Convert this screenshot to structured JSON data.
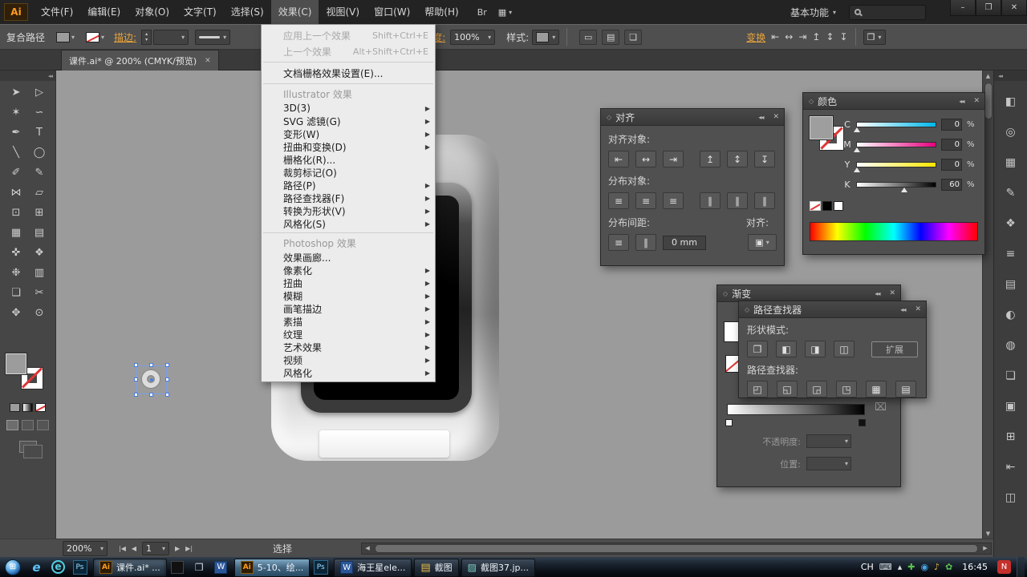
{
  "colors": {
    "accent_link": "#e8a33b",
    "selection_blue": "#4a7dde",
    "ai_brand_orange": "#ff9a1e",
    "menu_bg": "#ececec",
    "panel_bg": "#505050",
    "cyan": "#00b7eb",
    "magenta": "#e6007e",
    "yellow": "#ffe600",
    "black": "#000000"
  },
  "glyphs": {
    "caret_down": "▾",
    "caret_up": "▴",
    "submenu_arrow": "▶",
    "left_arrow": "◀",
    "right_arrow": "▶",
    "up_arrow": "▲",
    "down_arrow": "▼",
    "close": "✕",
    "collapse": "◂◂",
    "panel_menu": "≡",
    "diamond": "◇",
    "minimize": "–",
    "restore": "❐",
    "nav_first": "|◀",
    "nav_last": "▶|",
    "grid": "▦",
    "trash": "⌧",
    "start": "⊞",
    "end_icon": "❒"
  },
  "menubar": {
    "logo_text": "Ai",
    "items": [
      "文件(F)",
      "编辑(E)",
      "对象(O)",
      "文字(T)",
      "选择(S)",
      "效果(C)",
      "视图(V)",
      "窗口(W)",
      "帮助(H)"
    ],
    "bridge_label": "Br",
    "workspace_label": "基本功能"
  },
  "control_bar": {
    "selection_label": "复合路径",
    "stroke_link": "描边:",
    "opacity_link": "不透明度:",
    "opacity_value": "100%",
    "style_label": "样式:",
    "transform_link": "变换",
    "misc_icons": [
      "▭",
      "▤",
      "❏"
    ]
  },
  "document_tab": {
    "title": "课件.ai* @ 200%  (CMYK/预览)"
  },
  "effects_menu": {
    "items": [
      {
        "label": "应用上一个效果",
        "shortcut": "Shift+Ctrl+E",
        "disabled": true
      },
      {
        "label": "上一个效果",
        "shortcut": "Alt+Shift+Ctrl+E",
        "disabled": true
      },
      {
        "label": "文档栅格效果设置(E)..."
      },
      {
        "label": "Illustrator 效果",
        "header": true
      },
      {
        "label": "3D(3)",
        "submenu": true
      },
      {
        "label": "SVG 滤镜(G)",
        "submenu": true
      },
      {
        "label": "变形(W)",
        "submenu": true
      },
      {
        "label": "扭曲和变换(D)",
        "submenu": true
      },
      {
        "label": "栅格化(R)..."
      },
      {
        "label": "裁剪标记(O)"
      },
      {
        "label": "路径(P)",
        "submenu": true
      },
      {
        "label": "路径查找器(F)",
        "submenu": true
      },
      {
        "label": "转换为形状(V)",
        "submenu": true
      },
      {
        "label": "风格化(S)",
        "submenu": true
      },
      {
        "label": "Photoshop 效果",
        "header": true
      },
      {
        "label": "效果画廊..."
      },
      {
        "label": "像素化",
        "submenu": true
      },
      {
        "label": "扭曲",
        "submenu": true
      },
      {
        "label": "模糊",
        "submenu": true
      },
      {
        "label": "画笔描边",
        "submenu": true
      },
      {
        "label": "素描",
        "submenu": true
      },
      {
        "label": "纹理",
        "submenu": true
      },
      {
        "label": "艺术效果",
        "submenu": true
      },
      {
        "label": "视频",
        "submenu": true
      },
      {
        "label": "风格化",
        "submenu": true
      }
    ]
  },
  "tools": [
    {
      "name": "selection-tool",
      "glyph": "➤"
    },
    {
      "name": "direct-selection-tool",
      "glyph": "▷"
    },
    {
      "name": "magic-wand-tool",
      "glyph": "✶"
    },
    {
      "name": "lasso-tool",
      "glyph": "∽"
    },
    {
      "name": "pen-tool",
      "glyph": "✒"
    },
    {
      "name": "type-tool",
      "glyph": "T"
    },
    {
      "name": "line-segment-tool",
      "glyph": "╲"
    },
    {
      "name": "ellipse-tool",
      "glyph": "◯"
    },
    {
      "name": "paintbrush-tool",
      "glyph": "✐"
    },
    {
      "name": "pencil-tool",
      "glyph": "✎"
    },
    {
      "name": "width-tool",
      "glyph": "⋈"
    },
    {
      "name": "free-transform-tool",
      "glyph": "▱"
    },
    {
      "name": "shape-builder-tool",
      "glyph": "⊡"
    },
    {
      "name": "perspective-grid-tool",
      "glyph": "⊞"
    },
    {
      "name": "mesh-tool",
      "glyph": "▦"
    },
    {
      "name": "gradient-tool",
      "glyph": "▤"
    },
    {
      "name": "eyedropper-tool",
      "glyph": "✜"
    },
    {
      "name": "blend-tool",
      "glyph": "❖"
    },
    {
      "name": "symbol-sprayer-tool",
      "glyph": "❉"
    },
    {
      "name": "column-graph-tool",
      "glyph": "▥"
    },
    {
      "name": "artboard-tool",
      "glyph": "❏"
    },
    {
      "name": "slice-tool",
      "glyph": "✂"
    },
    {
      "name": "hand-tool",
      "glyph": "✥"
    },
    {
      "name": "zoom-tool",
      "glyph": "⊙"
    }
  ],
  "panels": {
    "align": {
      "title": "对齐",
      "align_objects_label": "对齐对象:",
      "distribute_objects_label": "分布对象:",
      "distribute_spacing_label": "分布间距:",
      "align_to_label": "对齐:",
      "spacing_value": "0 mm",
      "align_icons": [
        "⇤",
        "↔",
        "⇥",
        "↥",
        "↕",
        "↧"
      ],
      "distribute_icons": [
        "≡",
        "≡",
        "≡",
        "∥",
        "∥",
        "∥"
      ],
      "spacing_icons": [
        "≡",
        "∥"
      ],
      "align_to_icon": "▣"
    },
    "color": {
      "title": "颜色",
      "channels": [
        {
          "label": "C",
          "value": "0",
          "unit": "%"
        },
        {
          "label": "M",
          "value": "0",
          "unit": "%"
        },
        {
          "label": "Y",
          "value": "0",
          "unit": "%"
        },
        {
          "label": "K",
          "value": "60",
          "unit": "%"
        }
      ]
    },
    "pathfinder": {
      "title": "路径查找器",
      "shape_modes_label": "形状模式:",
      "expand_button": "扩展",
      "pathfinders_label": "路径查找器:",
      "shape_mode_icons": [
        "❐",
        "◧",
        "◨",
        "◫"
      ],
      "pathfinder_icons": [
        "◰",
        "◱",
        "◲",
        "◳",
        "▦",
        "▤"
      ]
    },
    "gradient": {
      "title": "渐变",
      "opacity_label": "不透明度:",
      "location_label": "位置:"
    }
  },
  "dock_icons": [
    {
      "name": "color-panel-icon",
      "glyph": "◧"
    },
    {
      "name": "color-guide-panel-icon",
      "glyph": "◎"
    },
    {
      "name": "swatches-panel-icon",
      "glyph": "▦"
    },
    {
      "name": "brushes-panel-icon",
      "glyph": "✎"
    },
    {
      "name": "symbols-panel-icon",
      "glyph": "❖"
    },
    {
      "name": "stroke-panel-icon",
      "glyph": "≡"
    },
    {
      "name": "gradient-panel-icon",
      "glyph": "▤"
    },
    {
      "name": "transparency-panel-icon",
      "glyph": "◐"
    },
    {
      "name": "appearance-panel-icon",
      "glyph": "◍"
    },
    {
      "name": "graphic-styles-panel-icon",
      "glyph": "❏"
    },
    {
      "name": "layers-panel-icon",
      "glyph": "▣"
    },
    {
      "name": "artboards-panel-icon",
      "glyph": "⊞"
    },
    {
      "name": "align-panel-icon",
      "glyph": "⇤"
    },
    {
      "name": "pathfinder-panel-icon",
      "glyph": "◫"
    }
  ],
  "status_bar": {
    "zoom": "200%",
    "artboard_number": "1",
    "tool_status": "选择"
  },
  "taskbar": {
    "ie_glyph": "e",
    "browser_glyph": "e",
    "photoshop_glyph": "Ps",
    "photoshop2_glyph": "Ps",
    "ai_glyph": "Ai",
    "word_glyph": "W",
    "explorer_glyph": "❒",
    "folder_glyph": "▤",
    "image_glyph": "▨",
    "buttons": [
      {
        "label": "课件.ai* ..."
      },
      {
        "label": "5-10、绘..."
      },
      {
        "label": "海王星ele..."
      },
      {
        "label": "截图"
      },
      {
        "label": "截图37.jp..."
      }
    ],
    "tray_icons": [
      {
        "name": "keyboard-icon",
        "glyph": "⌨",
        "color": "#d6dde4"
      },
      {
        "name": "show-hidden-icons",
        "glyph": "▴",
        "color": "#d6dde4"
      },
      {
        "name": "antivirus-icon",
        "glyph": "✚",
        "color": "#59c14e"
      },
      {
        "name": "network-icon",
        "glyph": "◉",
        "color": "#46a6e8"
      },
      {
        "name": "music-app-icon",
        "glyph": "♪",
        "color": "#e8b13b"
      },
      {
        "name": "chat-app-icon",
        "glyph": "✿",
        "color": "#59c14e"
      }
    ],
    "language_indicator": "CH",
    "clock": "16:45",
    "notify_glyph": "N"
  }
}
